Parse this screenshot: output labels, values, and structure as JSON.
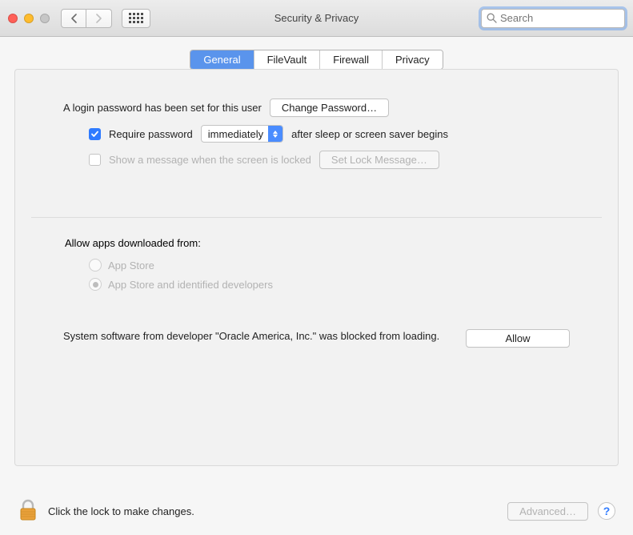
{
  "window": {
    "title": "Security & Privacy",
    "search_placeholder": "Search"
  },
  "tabs": {
    "general": "General",
    "filevault": "FileVault",
    "firewall": "Firewall",
    "privacy": "Privacy",
    "active": "general"
  },
  "login": {
    "password_set_text": "A login password has been set for this user",
    "change_password_label": "Change Password…",
    "require_password_label": "Require password",
    "delay_selected": "immediately",
    "after_sleep_text": "after sleep or screen saver begins",
    "show_message_label": "Show a message when the screen is locked",
    "set_lock_message_label": "Set Lock Message…",
    "require_password_checked": true,
    "show_message_checked": false
  },
  "gatekeeper": {
    "section_label": "Allow apps downloaded from:",
    "option_appstore": "App Store",
    "option_identified": "App Store and identified developers",
    "selected": "identified"
  },
  "blocked": {
    "message": "System software from developer \"Oracle America, Inc.\" was blocked from loading.",
    "allow_label": "Allow"
  },
  "footer": {
    "lock_text": "Click the lock to make changes.",
    "advanced_label": "Advanced…"
  }
}
